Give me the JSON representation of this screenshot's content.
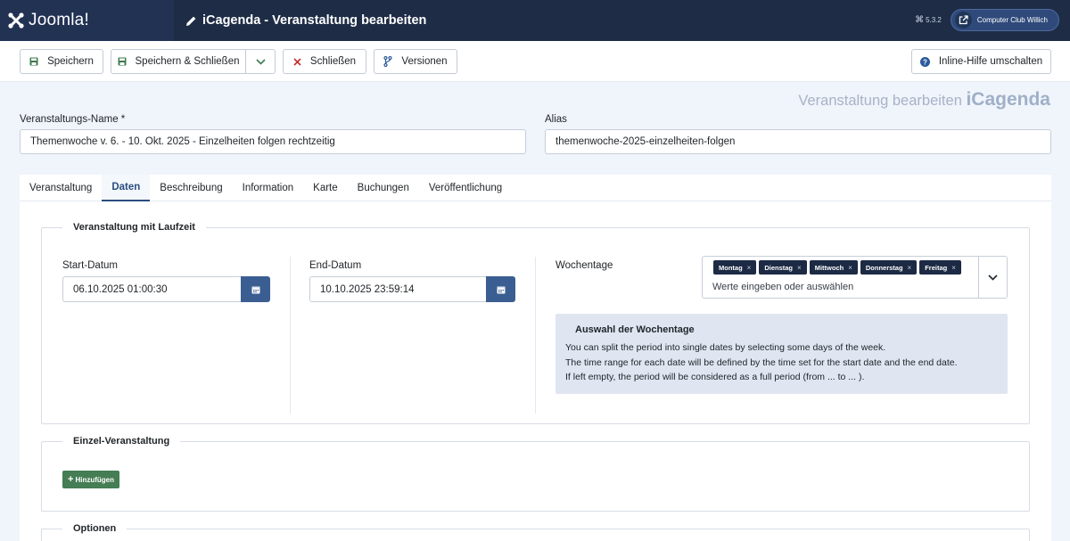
{
  "header": {
    "logo_text": "Joomla!",
    "page_title": "iCagenda - Veranstaltung bearbeiten",
    "version": "5.3.2",
    "site_button": "Computer Club Willich"
  },
  "toolbar": {
    "save": "Speichern",
    "save_close": "Speichern & Schließen",
    "close": "Schließen",
    "versions": "Versionen",
    "help": "Inline-Hilfe umschalten"
  },
  "watermark": {
    "text": "Veranstaltung bearbeiten",
    "brand": "iCagenda"
  },
  "form": {
    "name_label": "Veranstaltungs-Name *",
    "name_value": "Themenwoche v. 6. - 10. Okt. 2025 - Einzelheiten folgen rechtzeitig",
    "alias_label": "Alias",
    "alias_value": "themenwoche-2025-einzelheiten-folgen"
  },
  "tabs": [
    {
      "label": "Veranstaltung",
      "active": false
    },
    {
      "label": "Daten",
      "active": true
    },
    {
      "label": "Beschreibung",
      "active": false
    },
    {
      "label": "Information",
      "active": false
    },
    {
      "label": "Karte",
      "active": false
    },
    {
      "label": "Buchungen",
      "active": false
    },
    {
      "label": "Veröffentlichung",
      "active": false
    }
  ],
  "period": {
    "legend": "Veranstaltung mit Laufzeit",
    "start_label": "Start-Datum",
    "start_value": "06.10.2025 01:00:30",
    "end_label": "End-Datum",
    "end_value": "10.10.2025 23:59:14",
    "weekdays_label": "Wochentage",
    "weekday_tags": [
      "Montag",
      "Dienstag",
      "Mittwoch",
      "Donnerstag",
      "Freitag"
    ],
    "weekday_placeholder": "Werte eingeben oder auswählen",
    "info_title": "Auswahl der Wochentage",
    "info_lines": [
      "You can split the period into single dates by selecting some days of the week.",
      "The time range for each date will be defined by the time set for the start date and the end date.",
      "If left empty, the period will be considered as a full period (from ... to ... )."
    ]
  },
  "single": {
    "legend": "Einzel-Veranstaltung",
    "add_button": "Hinzufügen"
  },
  "options": {
    "legend": "Optionen"
  }
}
